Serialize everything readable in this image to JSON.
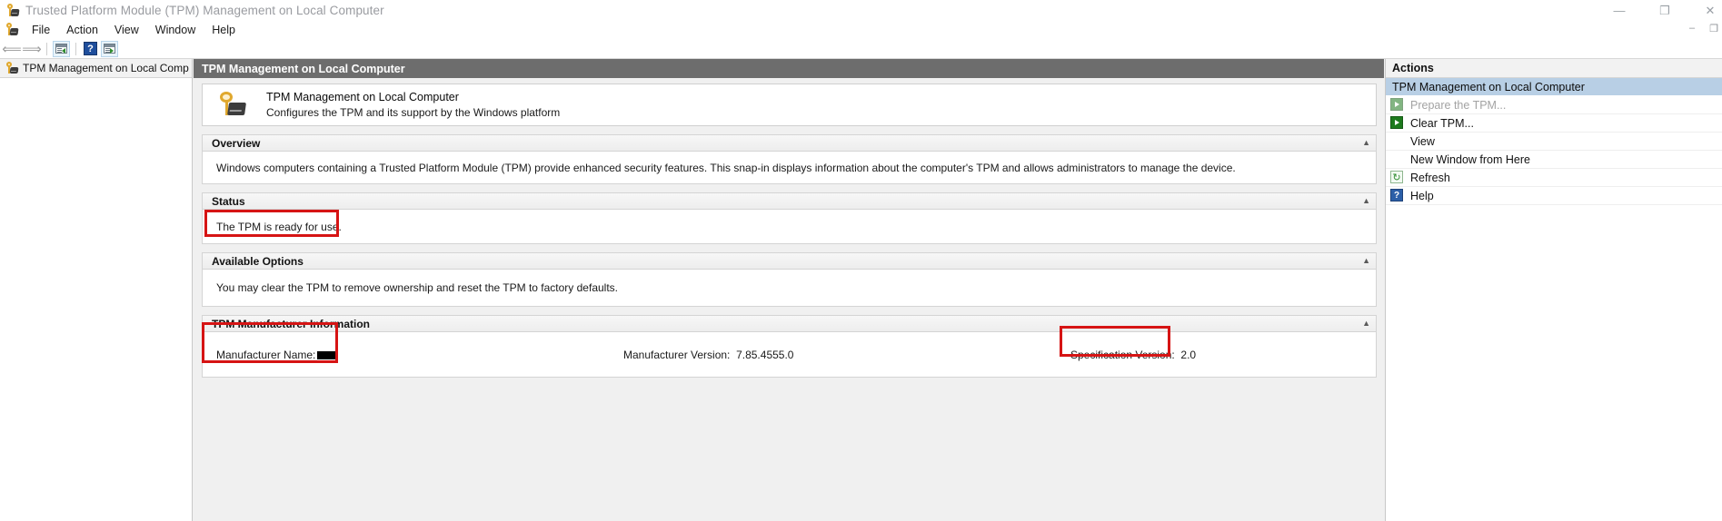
{
  "window": {
    "title": "Trusted Platform Module (TPM) Management on Local Computer",
    "icon": "tpm-key-icon",
    "controls": {
      "minimize": "—",
      "restore": "❐",
      "close": "✕",
      "inner_minimize": "–",
      "inner_restore": "❐"
    }
  },
  "menubar": {
    "icon": "tpm-key-icon",
    "items": [
      {
        "label": "File"
      },
      {
        "label": "Action"
      },
      {
        "label": "View"
      },
      {
        "label": "Window"
      },
      {
        "label": "Help"
      }
    ],
    "right_controls": {
      "minimize": "–",
      "restore": "❐"
    }
  },
  "toolbar": {
    "items": [
      {
        "name": "back-button",
        "glyph": "⟸"
      },
      {
        "name": "forward-button",
        "glyph": "⟹"
      },
      {
        "name": "show-hide-console-tree-button",
        "glyph": "console-tree-icon"
      },
      {
        "name": "help-button",
        "glyph": "?"
      },
      {
        "name": "show-hide-action-pane-button",
        "glyph": "action-pane-icon"
      }
    ]
  },
  "tree": {
    "root_label": "TPM Management on Local Comp",
    "root_icon": "tpm-node-icon"
  },
  "center": {
    "pane_title": "TPM Management on Local Computer",
    "hero": {
      "icon": "tpm-key-icon",
      "title": "TPM Management on Local Computer",
      "subtitle": "Configures the TPM and its support by the Windows platform"
    },
    "sections": [
      {
        "name": "overview",
        "heading": "Overview",
        "collapse_glyph": "▲",
        "body": "Windows computers containing a Trusted Platform Module (TPM) provide enhanced security features. This snap-in displays information about the computer's TPM and allows administrators to manage the device."
      },
      {
        "name": "status",
        "heading": "Status",
        "collapse_glyph": "▲",
        "body": "The TPM is ready for use.",
        "highlighted": true
      },
      {
        "name": "available-options",
        "heading": "Available Options",
        "collapse_glyph": "▲",
        "body": "You may clear the TPM to remove ownership and reset the TPM to factory defaults."
      },
      {
        "name": "tpm-manufacturer-information",
        "heading": "TPM Manufacturer Information",
        "collapse_glyph": "▲",
        "fields": [
          {
            "name": "manufacturer-name",
            "label": "Manufacturer Name:",
            "value": "",
            "redacted": true,
            "highlighted": true
          },
          {
            "name": "manufacturer-version",
            "label": "Manufacturer Version:",
            "value": "7.85.4555.0",
            "redacted": false,
            "highlighted": false
          },
          {
            "name": "specification-version",
            "label": "Specification Version:",
            "value": "2.0",
            "redacted": false,
            "highlighted": true
          }
        ]
      }
    ]
  },
  "actions": {
    "header": "Actions",
    "group_title": "TPM Management on Local Computer",
    "items": [
      {
        "name": "prepare-the-tpm",
        "label": "Prepare the TPM...",
        "icon": "green-arrow-icon",
        "disabled": true
      },
      {
        "name": "clear-tpm",
        "label": "Clear TPM...",
        "icon": "green-arrow-icon",
        "disabled": false
      },
      {
        "name": "view",
        "label": "View",
        "icon": "",
        "disabled": false
      },
      {
        "name": "new-window-from-here",
        "label": "New Window from Here",
        "icon": "",
        "disabled": false
      },
      {
        "name": "refresh",
        "label": "Refresh",
        "icon": "refresh-icon",
        "disabled": false
      },
      {
        "name": "help",
        "label": "Help",
        "icon": "help-icon",
        "disabled": false
      }
    ]
  },
  "annotations": {
    "accent_color": "#d61414",
    "boxes": [
      "status-value",
      "manufacturer-name",
      "specification-version"
    ]
  }
}
